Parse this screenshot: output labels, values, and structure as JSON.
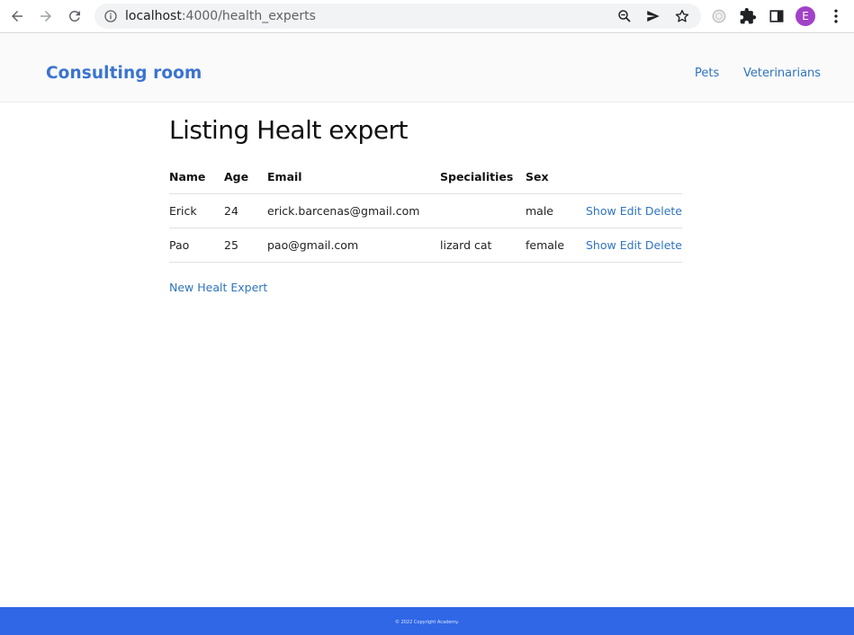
{
  "browser": {
    "url_host": "localhost",
    "url_rest": ":4000/health_experts",
    "profile_initial": "E",
    "icons": {
      "back": "back-arrow-icon",
      "forward": "forward-arrow-icon",
      "reload": "reload-icon",
      "info": "info-icon",
      "zoom": "zoom-icon",
      "share": "send-icon",
      "bookmark": "star-icon",
      "extension1": "extension-circle-icon",
      "extensions": "puzzle-icon",
      "sidepanel": "side-panel-icon",
      "menu": "kebab-menu-icon"
    }
  },
  "header": {
    "brand": "Consulting room",
    "nav": [
      {
        "label": "Pets"
      },
      {
        "label": "Veterinarians"
      }
    ]
  },
  "main": {
    "title": "Listing Healt expert",
    "table": {
      "columns": [
        "Name",
        "Age",
        "Email",
        "Specialities",
        "Sex",
        ""
      ],
      "rows": [
        {
          "name": "Erick",
          "age": "24",
          "email": "erick.barcenas@gmail.com",
          "specialities": "",
          "sex": "male",
          "actions": [
            "Show",
            "Edit",
            "Delete"
          ]
        },
        {
          "name": "Pao",
          "age": "25",
          "email": "pao@gmail.com",
          "specialities": "lizard cat",
          "sex": "female",
          "actions": [
            "Show",
            "Edit",
            "Delete"
          ]
        }
      ]
    },
    "new_link": "New Healt Expert"
  },
  "footer": {
    "text": "© 2022 Copyright Academy."
  },
  "colors": {
    "brand": "#3b73d1",
    "link": "#2f74c0",
    "footer_bg": "#2f67e6",
    "avatar": "#a142c8"
  }
}
